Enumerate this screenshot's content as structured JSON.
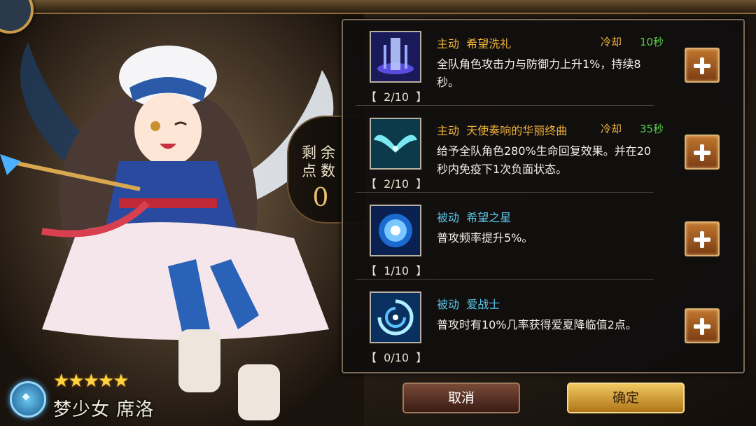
{
  "points": {
    "label": "剩余点数",
    "value": "0"
  },
  "skills": [
    {
      "type": "主动",
      "name": "希望洗礼",
      "cooldown_label": "冷却",
      "cooldown_value": "10秒",
      "description": "全队角色攻击力与防御力上升1%，持续8秒。",
      "level": "【  2/10  】",
      "icon": "light-pillar-icon",
      "kind": "active"
    },
    {
      "type": "主动",
      "name": "天使奏响的华丽终曲",
      "cooldown_label": "冷却",
      "cooldown_value": "35秒",
      "description": "给予全队角色280%生命回复效果。并在20秒内免疫下1次负面状态。",
      "level": "【  2/10  】",
      "icon": "angel-wings-icon",
      "kind": "active"
    },
    {
      "type": "被动",
      "name": "希望之星",
      "cooldown_label": "",
      "cooldown_value": "",
      "description": "普攻频率提升5%。",
      "level": "【  1/10  】",
      "icon": "star-burst-icon",
      "kind": "passive"
    },
    {
      "type": "被动",
      "name": "爱战士",
      "cooldown_label": "",
      "cooldown_value": "",
      "description": "普攻时有10%几率获得爱夏降临值2点。",
      "level": "【  0/10  】",
      "icon": "vortex-icon",
      "kind": "passive"
    }
  ],
  "buttons": {
    "cancel": "取消",
    "confirm": "确定"
  },
  "character": {
    "stars": "★★★★★",
    "name": "梦少女 席洛",
    "star_count": 5
  },
  "colors": {
    "active": "#f0b23a",
    "passive": "#5bc6e8",
    "cooldown_value": "#5ad14a"
  }
}
